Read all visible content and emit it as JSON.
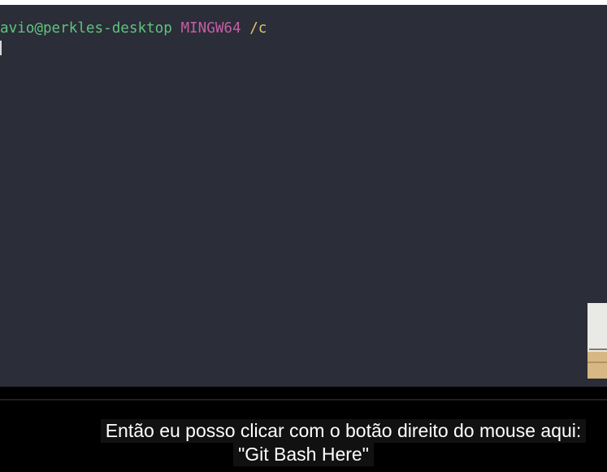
{
  "terminal": {
    "prompt": {
      "user_host": "avio@perkles-desktop",
      "shell": "MINGW64",
      "cwd": "/c"
    },
    "colors": {
      "background": "#2b2d38",
      "user_host": "#5ec47e",
      "shell": "#c55fa6",
      "cwd": "#d9c773"
    }
  },
  "caption": {
    "line1": "Então eu posso clicar com o botão direito do mouse aqui:",
    "line2": "\"Git Bash Here\""
  }
}
